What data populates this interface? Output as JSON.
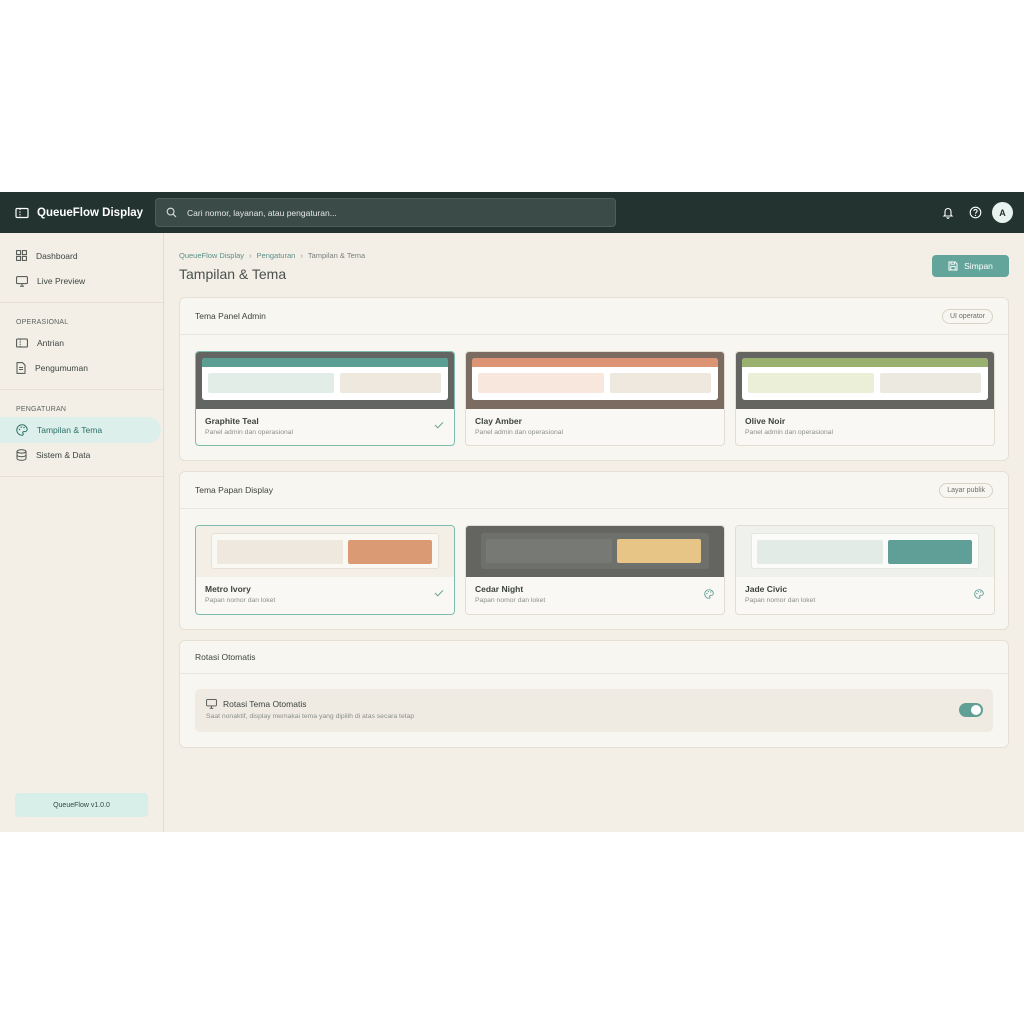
{
  "app": {
    "brand": "QueueFlow Display",
    "search_placeholder": "Cari nomor, layanan, atau pengaturan...",
    "avatar_initial": "A"
  },
  "sidebar": {
    "main_items": [
      {
        "label": "Dashboard",
        "icon": "grid-icon"
      },
      {
        "label": "Live Preview",
        "icon": "monitor-icon"
      }
    ],
    "operasional": {
      "heading": "OPERASIONAL",
      "items": [
        {
          "label": "Antrian",
          "icon": "ticket-icon"
        },
        {
          "label": "Pengumuman",
          "icon": "document-icon"
        }
      ]
    },
    "pengaturan": {
      "heading": "PENGATURAN",
      "items": [
        {
          "label": "Tampilan & Tema",
          "icon": "palette-icon",
          "active": true
        },
        {
          "label": "Sistem & Data",
          "icon": "database-icon"
        }
      ]
    },
    "version": "QueueFlow v1.0.0"
  },
  "breadcrumb": [
    "QueueFlow Display",
    "Pengaturan",
    "Tampilan & Tema"
  ],
  "page_title": "Tampilan & Tema",
  "save_label": "Simpan",
  "admin_themes": {
    "title": "Tema Panel Admin",
    "pill": "UI operator",
    "items": [
      {
        "name": "Graphite Teal",
        "desc": "Panel admin dan operasional",
        "selected": true,
        "frame": "#636562",
        "bar": "#5a9e94",
        "left": "#e3ede8",
        "right": "#efe8df"
      },
      {
        "name": "Clay Amber",
        "desc": "Panel admin dan operasional",
        "selected": false,
        "frame": "#7b6b60",
        "bar": "#dc9474",
        "left": "#f7e7dd",
        "right": "#efe8df"
      },
      {
        "name": "Olive Noir",
        "desc": "Panel admin dan operasional",
        "selected": false,
        "frame": "#646561",
        "bar": "#9ab06f",
        "left": "#ecefd8",
        "right": "#ece9e1"
      }
    ]
  },
  "display_themes": {
    "title": "Tema Papan Display",
    "pill": "Layar publik",
    "items": [
      {
        "name": "Metro Ivory",
        "desc": "Papan nomor dan loket",
        "selected": true,
        "bg": "#f3efe6",
        "win": "#faf8f3",
        "left": "#efe8df",
        "right": "#d99a74"
      },
      {
        "name": "Cedar Night",
        "desc": "Papan nomor dan loket",
        "selected": false,
        "bg": "#646561",
        "win": "#6e706b",
        "left": "#777974",
        "right": "#e6c587"
      },
      {
        "name": "Jade Civic",
        "desc": "Papan nomor dan loket",
        "selected": false,
        "bg": "#eff1ed",
        "win": "#fbfbf9",
        "left": "#e3ebe6",
        "right": "#5f9f97"
      }
    ]
  },
  "rotation": {
    "title": "Rotasi Otomatis",
    "item_title": "Rotasi Tema Otomatis",
    "item_desc": "Saat nonaktif, display memakai tema yang dipilih di atas secara tetap",
    "enabled": true
  },
  "colors": {
    "accent": "#64a59b",
    "topbar": "#223330",
    "sidebar_active": "#dcefea"
  }
}
